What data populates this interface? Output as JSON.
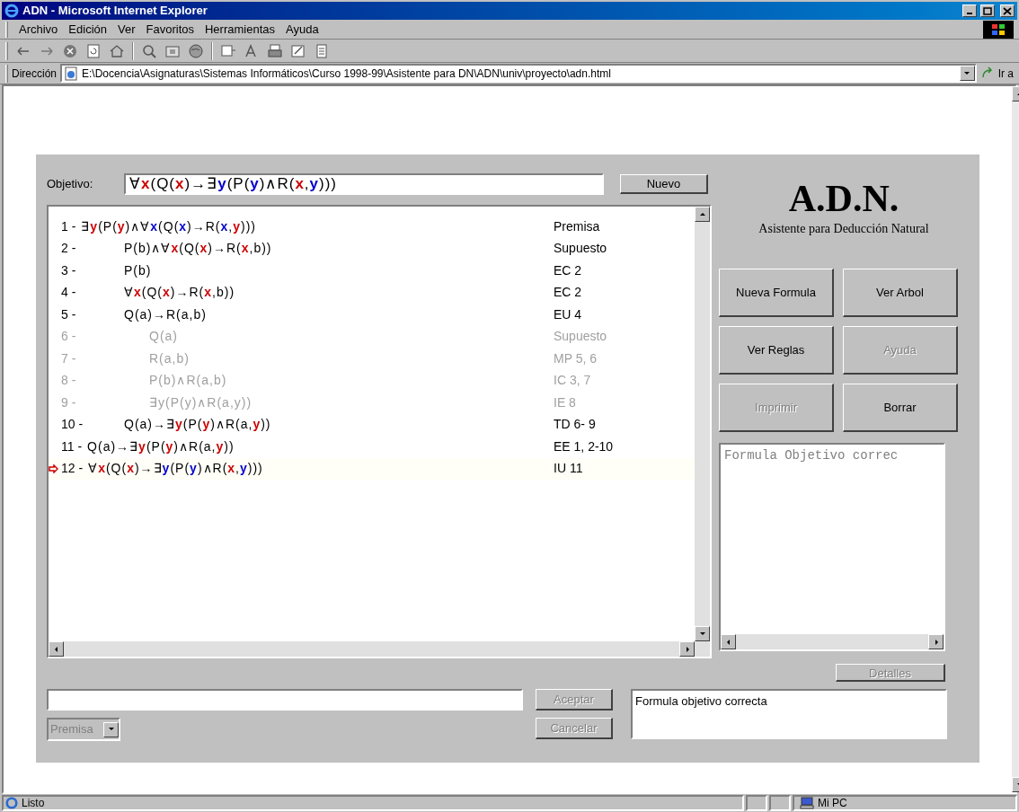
{
  "window": {
    "title": "ADN - Microsoft Internet Explorer"
  },
  "menu": [
    "Archivo",
    "Edición",
    "Ver",
    "Favoritos",
    "Herramientas",
    "Ayuda"
  ],
  "address": {
    "label": "Dirección",
    "value": "E:\\Docencia\\Asignaturas\\Sistemas Informáticos\\Curso 1998-99\\Asistente para DN\\ADN\\univ\\proyecto\\adn.html",
    "go_label": "Ir a"
  },
  "page": {
    "goal": {
      "label": "Objetivo:",
      "formula": [
        {
          "text": "∀"
        },
        {
          "text": "x",
          "color": "#cc0000"
        },
        {
          "text": "(Q("
        },
        {
          "text": "x",
          "color": "#cc0000"
        },
        {
          "text": ")→∃"
        },
        {
          "text": "y",
          "color": "#0000cc"
        },
        {
          "text": "(P("
        },
        {
          "text": "y",
          "color": "#0000cc"
        },
        {
          "text": ")∧R("
        },
        {
          "text": "x",
          "color": "#cc0000"
        },
        {
          "text": ","
        },
        {
          "text": "y",
          "color": "#0000cc"
        },
        {
          "text": ")))"
        }
      ]
    },
    "new_button": "Nuevo",
    "proof": [
      {
        "kind": "line",
        "number": "1 -",
        "rule": "Premisa",
        "disabled": false,
        "current": false,
        "formula": [
          {
            "text": "∃"
          },
          {
            "text": "y",
            "color": "#cc0000"
          },
          {
            "text": "(P("
          },
          {
            "text": "y",
            "color": "#cc0000"
          },
          {
            "text": ")∧∀"
          },
          {
            "text": "x",
            "color": "#0000cc"
          },
          {
            "text": "(Q("
          },
          {
            "text": "x",
            "color": "#0000cc"
          },
          {
            "text": ")→R("
          },
          {
            "text": "x",
            "color": "#0000cc"
          },
          {
            "text": ","
          },
          {
            "text": "y",
            "color": "#cc0000"
          },
          {
            "text": ")))"
          }
        ]
      },
      {
        "kind": "block",
        "children": [
          {
            "kind": "line",
            "number": "2 -",
            "rule": "Supuesto",
            "disabled": false,
            "current": false,
            "formula": [
              {
                "text": "P(b)∧∀"
              },
              {
                "text": "x",
                "color": "#cc0000"
              },
              {
                "text": "(Q("
              },
              {
                "text": "x",
                "color": "#cc0000"
              },
              {
                "text": ")→R("
              },
              {
                "text": "x",
                "color": "#cc0000"
              },
              {
                "text": ",b))"
              }
            ]
          },
          {
            "kind": "line",
            "number": "3 -",
            "rule": "EC 2",
            "disabled": false,
            "current": false,
            "formula": [
              {
                "text": "P(b)"
              }
            ]
          },
          {
            "kind": "line",
            "number": "4 -",
            "rule": "EC 2",
            "disabled": false,
            "current": false,
            "formula": [
              {
                "text": "∀"
              },
              {
                "text": "x",
                "color": "#cc0000"
              },
              {
                "text": "(Q("
              },
              {
                "text": "x",
                "color": "#cc0000"
              },
              {
                "text": ")→R("
              },
              {
                "text": "x",
                "color": "#cc0000"
              },
              {
                "text": ",b))"
              }
            ]
          },
          {
            "kind": "line",
            "number": "5 -",
            "rule": "EU 4",
            "disabled": false,
            "current": false,
            "formula": [
              {
                "text": "Q(a)→R(a,b)"
              }
            ]
          },
          {
            "kind": "block",
            "children": [
              {
                "kind": "line",
                "number": "6 -",
                "rule": "Supuesto",
                "disabled": true,
                "current": false,
                "formula": [
                  {
                    "text": "Q(a)"
                  }
                ]
              },
              {
                "kind": "line",
                "number": "7 -",
                "rule": "MP 5, 6",
                "disabled": true,
                "current": false,
                "formula": [
                  {
                    "text": "R(a,b)"
                  }
                ]
              },
              {
                "kind": "line",
                "number": "8 -",
                "rule": "IC 3, 7",
                "disabled": true,
                "current": false,
                "formula": [
                  {
                    "text": "P(b)∧R(a,b)"
                  }
                ]
              },
              {
                "kind": "line",
                "number": "9 -",
                "rule": "IE 8",
                "disabled": true,
                "current": false,
                "formula": [
                  {
                    "text": "∃y(P(y)∧R(a,y))"
                  }
                ]
              }
            ]
          },
          {
            "kind": "line",
            "number": "10 -",
            "rule": "TD 6- 9",
            "disabled": false,
            "current": false,
            "formula": [
              {
                "text": "Q(a)→∃"
              },
              {
                "text": "y",
                "color": "#cc0000"
              },
              {
                "text": "(P("
              },
              {
                "text": "y",
                "color": "#cc0000"
              },
              {
                "text": ")∧R(a,"
              },
              {
                "text": "y",
                "color": "#cc0000"
              },
              {
                "text": "))"
              }
            ]
          }
        ]
      },
      {
        "kind": "line",
        "number": "11 -",
        "rule": "EE 1, 2-10",
        "disabled": false,
        "current": false,
        "formula": [
          {
            "text": "Q(a)→∃"
          },
          {
            "text": "y",
            "color": "#cc0000"
          },
          {
            "text": "(P("
          },
          {
            "text": "y",
            "color": "#cc0000"
          },
          {
            "text": ")∧R(a,"
          },
          {
            "text": "y",
            "color": "#cc0000"
          },
          {
            "text": "))"
          }
        ]
      },
      {
        "kind": "line",
        "number": "12 -",
        "rule": "IU 11",
        "disabled": false,
        "current": true,
        "formula": [
          {
            "text": "∀"
          },
          {
            "text": "x",
            "color": "#cc0000"
          },
          {
            "text": "(Q("
          },
          {
            "text": "x",
            "color": "#cc0000"
          },
          {
            "text": ")→∃"
          },
          {
            "text": "y",
            "color": "#0000cc"
          },
          {
            "text": "(P("
          },
          {
            "text": "y",
            "color": "#0000cc"
          },
          {
            "text": ")∧R("
          },
          {
            "text": "x",
            "color": "#cc0000"
          },
          {
            "text": ","
          },
          {
            "text": "y",
            "color": "#0000cc"
          },
          {
            "text": ")))"
          }
        ]
      }
    ],
    "app_title": "A.D.N.",
    "app_subtitle": "Asistente para Deducción Natural",
    "actions": [
      {
        "label": "Nueva Formula",
        "disabled": false
      },
      {
        "label": "Ver Arbol",
        "disabled": false
      },
      {
        "label": "Ver Reglas",
        "disabled": false
      },
      {
        "label": "Ayuda",
        "disabled": true
      },
      {
        "label": "Imprimir",
        "disabled": true
      },
      {
        "label": "Borrar",
        "disabled": false
      }
    ],
    "log": "Formula Objetivo correc",
    "details_button": {
      "label": "Detalles",
      "disabled": true
    },
    "accept_button": {
      "label": "Aceptar",
      "disabled": true
    },
    "cancel_button": {
      "label": "Cancelar",
      "disabled": true
    },
    "rule_select": {
      "value": "Premisa",
      "disabled": true
    },
    "message": "Formula objetivo correcta"
  },
  "status_bar": {
    "text": "Listo",
    "zone": "Mi PC"
  }
}
